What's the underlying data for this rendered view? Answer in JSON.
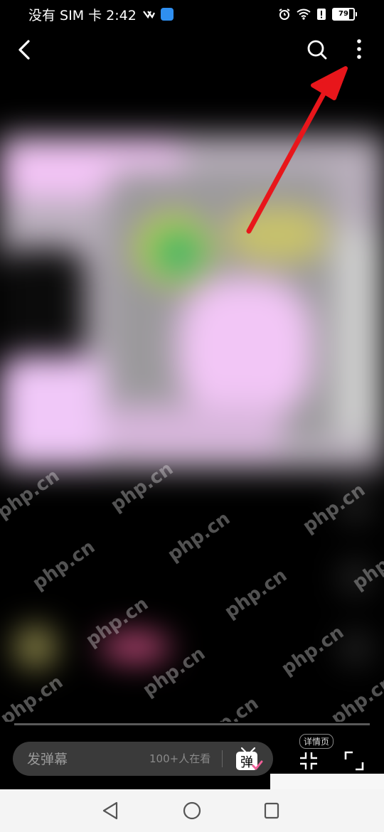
{
  "status_bar": {
    "carrier_time": "没有 SIM 卡 2:42",
    "battery_level": "79",
    "icons": [
      "alarm-icon",
      "wifi-icon",
      "alert-icon",
      "battery-icon"
    ]
  },
  "top_nav": {
    "icons": [
      "back-icon",
      "search-icon",
      "more-icon"
    ]
  },
  "video": {
    "watermark": "php.cn"
  },
  "bottom_controls": {
    "danmaku_placeholder": "发弹幕",
    "viewer_count": "100+人在看",
    "danmaku_toggle_label": "弹",
    "detail_label": "详情页"
  },
  "colors": {
    "accent_arrow": "#e8161b",
    "danmaku_pink": "#f05f98",
    "pill_bg": "#3a3a3a"
  }
}
